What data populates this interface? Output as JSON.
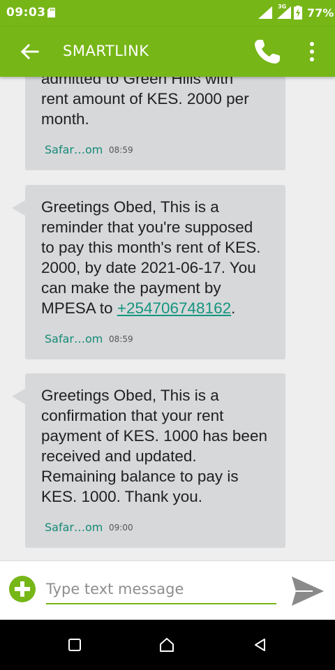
{
  "status_bar": {
    "time": "09:03",
    "network_type": "3G",
    "battery": "77%",
    "icons": [
      "sd-card-icon",
      "signal-icon",
      "signal-3g-icon",
      "battery-charging-icon"
    ]
  },
  "app_bar": {
    "title": "SMARTLINK",
    "icons": [
      "back-arrow-icon",
      "phone-icon",
      "more-vert-icon"
    ]
  },
  "messages": [
    {
      "text": "admitted to Green Hills with\nrent amount of KES. 2000 per\nmonth.",
      "sender": "Safar…om",
      "time": "08:59"
    },
    {
      "text": "Greetings Obed, This is a\nreminder that you're supposed\nto pay this month's rent of KES.\n2000, by date 2021-06-17. You\ncan make the payment by\nMPESA to ",
      "link": "+254706748162",
      "text_after": ".",
      "sender": "Safar…om",
      "time": "08:59"
    },
    {
      "text": "Greetings Obed, This is a\nconfirmation that your rent\npayment of KES. 1000 has been\nreceived and updated.\nRemaining balance to pay is\nKES. 1000. Thank you.",
      "sender": "Safar…om",
      "time": "09:00"
    }
  ],
  "compose": {
    "placeholder": "Type text message",
    "icons": [
      "add-circle-icon",
      "send-icon"
    ]
  },
  "nav_bar": {
    "icons": [
      "recents-icon",
      "home-icon",
      "back-icon"
    ]
  },
  "colors": {
    "accent": "#76b617",
    "bubble": "#d6d8da",
    "link": "#15957f",
    "sender": "#158a77"
  }
}
